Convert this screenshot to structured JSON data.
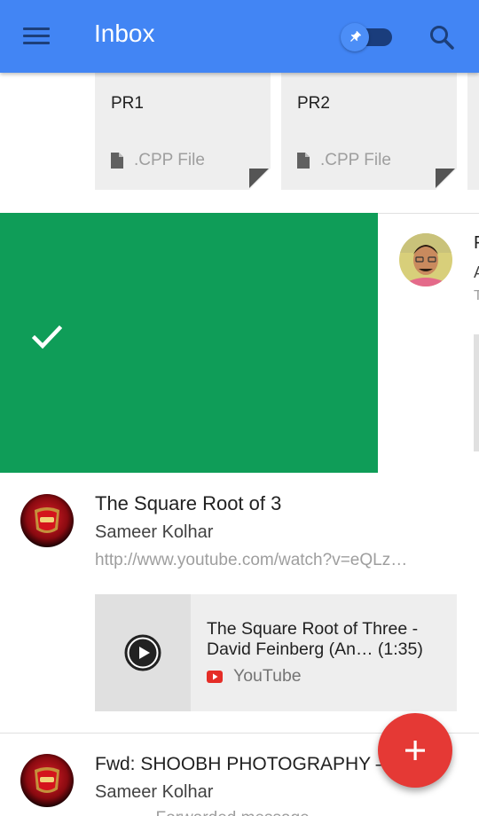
{
  "appbar": {
    "title": "Inbox",
    "menu_icon": "hamburger-menu-icon",
    "toggle_icon": "pin-icon",
    "search_icon": "search-icon"
  },
  "attachments": [
    {
      "name": "PR1",
      "type": ".CPP File",
      "icon": "file-icon"
    },
    {
      "name": "PR2",
      "type": ".CPP File",
      "icon": "file-icon"
    }
  ],
  "swipe_action": {
    "icon": "checkmark-icon",
    "color": "#0f9d58",
    "fragments": [
      "F",
      "A",
      "T"
    ]
  },
  "emails": [
    {
      "subject": "The Square Root of 3",
      "sender": "Sameer Kolhar",
      "snippet": "http://www.youtube.com/watch?v=eQLz…",
      "video": {
        "title": "The Square Root of Three - David Feinberg (An…  (1:35)",
        "source": "YouTube"
      }
    },
    {
      "subject": "Fwd: SHOOBH PHOTOGRAPHY – Ne…",
      "sender": "Sameer Kolhar",
      "snippet": "---------- Forwarded message ----------"
    }
  ],
  "fab": {
    "icon": "plus-icon",
    "color": "#e53935"
  },
  "colors": {
    "appbar": "#4285f4",
    "accent": "#e53935",
    "done": "#0f9d58"
  }
}
